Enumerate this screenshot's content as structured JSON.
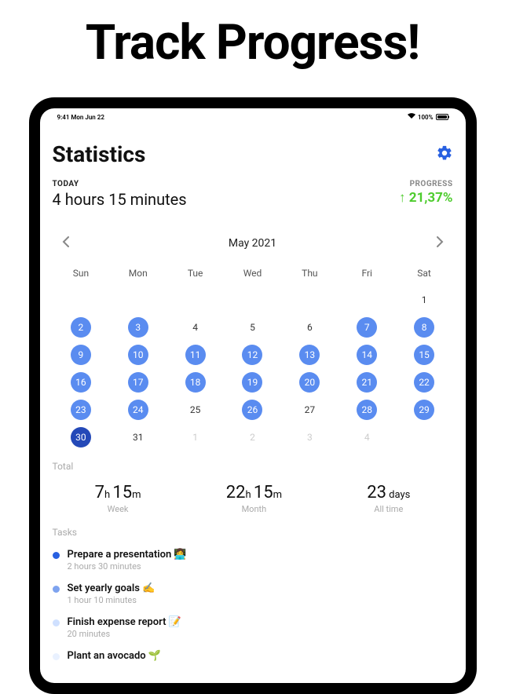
{
  "headline": "Track Progress!",
  "statusbar": {
    "time": "9:41 Mon Jun 22",
    "battery_pct": "100%"
  },
  "header": {
    "title": "Statistics"
  },
  "today": {
    "label": "TODAY",
    "value": "4 hours 15 minutes"
  },
  "progress": {
    "label": "PROGRESS",
    "arrow": "↑",
    "value": "21,37%"
  },
  "calendar": {
    "month": "May 2021",
    "dow": [
      "Sun",
      "Mon",
      "Tue",
      "Wed",
      "Thu",
      "Fri",
      "Sat"
    ],
    "cells": [
      {
        "n": "",
        "cls": "plain"
      },
      {
        "n": "",
        "cls": "plain"
      },
      {
        "n": "",
        "cls": "plain"
      },
      {
        "n": "",
        "cls": "plain"
      },
      {
        "n": "",
        "cls": "plain"
      },
      {
        "n": "",
        "cls": "plain"
      },
      {
        "n": "1",
        "cls": "plain"
      },
      {
        "n": "2",
        "cls": "hl"
      },
      {
        "n": "3",
        "cls": "hl"
      },
      {
        "n": "4",
        "cls": "plain"
      },
      {
        "n": "5",
        "cls": "plain"
      },
      {
        "n": "6",
        "cls": "plain"
      },
      {
        "n": "7",
        "cls": "hl"
      },
      {
        "n": "8",
        "cls": "hl"
      },
      {
        "n": "9",
        "cls": "hl"
      },
      {
        "n": "10",
        "cls": "hl"
      },
      {
        "n": "11",
        "cls": "hl"
      },
      {
        "n": "12",
        "cls": "hl"
      },
      {
        "n": "13",
        "cls": "hl"
      },
      {
        "n": "14",
        "cls": "hl"
      },
      {
        "n": "15",
        "cls": "hl"
      },
      {
        "n": "16",
        "cls": "hl"
      },
      {
        "n": "17",
        "cls": "hl"
      },
      {
        "n": "18",
        "cls": "hl"
      },
      {
        "n": "19",
        "cls": "hl"
      },
      {
        "n": "20",
        "cls": "hl"
      },
      {
        "n": "21",
        "cls": "hl"
      },
      {
        "n": "22",
        "cls": "hl"
      },
      {
        "n": "23",
        "cls": "hl"
      },
      {
        "n": "24",
        "cls": "hl"
      },
      {
        "n": "25",
        "cls": "plain"
      },
      {
        "n": "26",
        "cls": "hl"
      },
      {
        "n": "27",
        "cls": "plain"
      },
      {
        "n": "28",
        "cls": "hl"
      },
      {
        "n": "29",
        "cls": "hl"
      },
      {
        "n": "30",
        "cls": "sel"
      },
      {
        "n": "31",
        "cls": "plain"
      },
      {
        "n": "1",
        "cls": "dim"
      },
      {
        "n": "2",
        "cls": "dim"
      },
      {
        "n": "3",
        "cls": "dim"
      },
      {
        "n": "4",
        "cls": "dim"
      },
      {
        "n": "",
        "cls": "plain"
      }
    ]
  },
  "totals": {
    "label": "Total",
    "week": {
      "h": "7",
      "hm_unit1": "h ",
      "m": "15",
      "m_unit": "m",
      "label": "Week"
    },
    "month": {
      "h": "22",
      "hm_unit1": "h ",
      "m": "15",
      "m_unit": "m",
      "label": "Month"
    },
    "all": {
      "n": "23",
      "unit": " days",
      "label": "All time"
    }
  },
  "tasks": {
    "label": "Tasks",
    "items": [
      {
        "color": "#2860e1",
        "title": "Prepare a presentation 👩‍💻",
        "sub": "2 hours 30 minutes"
      },
      {
        "color": "#7ea3ef",
        "title": "Set yearly goals ✍️",
        "sub": "1 hour 10 minutes"
      },
      {
        "color": "#cfe0ff",
        "title": "Finish expense report 📝",
        "sub": "20 minutes"
      },
      {
        "color": "#e9f1ff",
        "title": "Plant an avocado 🌱",
        "sub": ""
      }
    ]
  }
}
